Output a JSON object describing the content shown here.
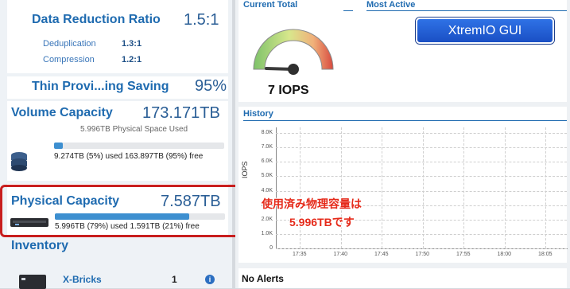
{
  "data_reduction": {
    "title": "Data Reduction Ratio",
    "value": "1.5:1",
    "dedup_label": "Deduplication",
    "dedup_value": "1.3:1",
    "compression_label": "Compression",
    "compression_value": "1.2:1"
  },
  "thin": {
    "title": "Thin Provi...ing Saving",
    "value": "95%"
  },
  "volume": {
    "title": "Volume Capacity",
    "value": "173.171TB",
    "physical_used": "5.996TB Physical Space Used",
    "usage": "9.274TB (5%) used 163.897TB (95%) free",
    "percent_used": 5
  },
  "physical": {
    "title": "Physical Capacity",
    "value": "7.587TB",
    "usage": "5.996TB (79%) used 1.591TB (21%) free",
    "percent_used": 79
  },
  "inventory": {
    "title": "Inventory",
    "xbricks_label": "X-Bricks",
    "xbricks_count": "1"
  },
  "current_total": {
    "title": "Current Total",
    "iops": "7 IOPS"
  },
  "most_active": {
    "title": "Most Active"
  },
  "overlay": {
    "button": "XtremIO GUI",
    "jp_line1": "使用済み物理容量は",
    "jp_line2": "5.996TBです"
  },
  "history": {
    "title": "History",
    "ylabel": "IOPS",
    "yticks": [
      "8.0K",
      "7.0K",
      "6.0K",
      "5.0K",
      "4.0K",
      "3.0K",
      "2.0K",
      "1.0K",
      "0"
    ],
    "xticks": [
      "17:35",
      "17:40",
      "17:45",
      "17:50",
      "17:55",
      "18:00",
      "18:05"
    ]
  },
  "alerts": {
    "title": "No Alerts"
  }
}
